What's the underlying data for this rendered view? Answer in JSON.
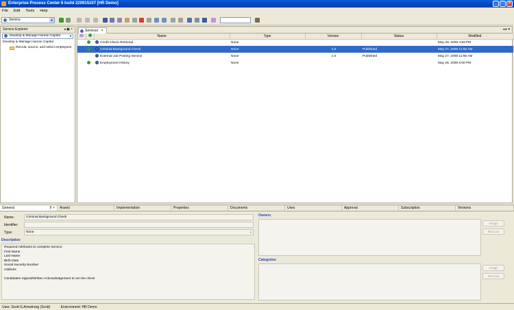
{
  "window": {
    "title": "Enterprise Process Center 6 build 220915107 [HR Demo]"
  },
  "menu": [
    "File",
    "Edit",
    "Tools",
    "Help"
  ],
  "toolbar": {
    "selector": "Service"
  },
  "explorer": {
    "title": "Service Explorer",
    "selector": "Develop & Manage Human Capital",
    "tree": {
      "root": "Develop & Manage Human Capital",
      "child": "Recruit, source, and select employees"
    }
  },
  "services": {
    "tab": "Services",
    "columns": [
      "Name",
      "Type",
      "Version",
      "Status",
      "Modified"
    ],
    "rows": [
      {
        "status_ok": true,
        "name": "Credit Check Retrieval",
        "type": "None",
        "version": "",
        "status": "",
        "modified": "May 28, 2009 4:59 PM",
        "selected": false
      },
      {
        "status_ok": true,
        "name": "Criminal Background Check",
        "type": "None",
        "version": "1.0",
        "status": "Published",
        "modified": "May 27, 2009 11:55 AM",
        "selected": true
      },
      {
        "status_ok": false,
        "name": "External Job Posting Service",
        "type": "None",
        "version": "1.0",
        "status": "Published",
        "modified": "May 27, 2009 11:55 AM",
        "selected": false
      },
      {
        "status_ok": true,
        "name": "Employment History",
        "type": "None",
        "version": "",
        "status": "",
        "modified": "May 28, 2009 5:00 PM",
        "selected": false
      }
    ]
  },
  "bottom": {
    "tabs": [
      "General",
      "Assets",
      "Implementation",
      "Properties",
      "Documents",
      "Uses",
      "Approval",
      "Subscription",
      "Versions"
    ],
    "general": {
      "name_label": "Name:",
      "name_value": "Criminal Background Check",
      "identifier_label": "Identifier:",
      "identifier_value": "",
      "type_label": "Type:",
      "type_value": "None",
      "description_title": "Description",
      "description": "Required Attributes to complete Service:\nFirst Name\nLast Name\nBirth Date\nSocial Security Number\nAddress\n\nCandidates Signed/Written Acknowledgement to run the check"
    },
    "owners": {
      "title": "Owners",
      "assign": "Assign",
      "remove": "Remove"
    },
    "categories": {
      "title": "Categories",
      "assign": "Assign",
      "remove": "Remove"
    }
  },
  "status": {
    "user": "User: Scott G Armstrong (Scott)",
    "environment": "Environment: HR Demo"
  }
}
